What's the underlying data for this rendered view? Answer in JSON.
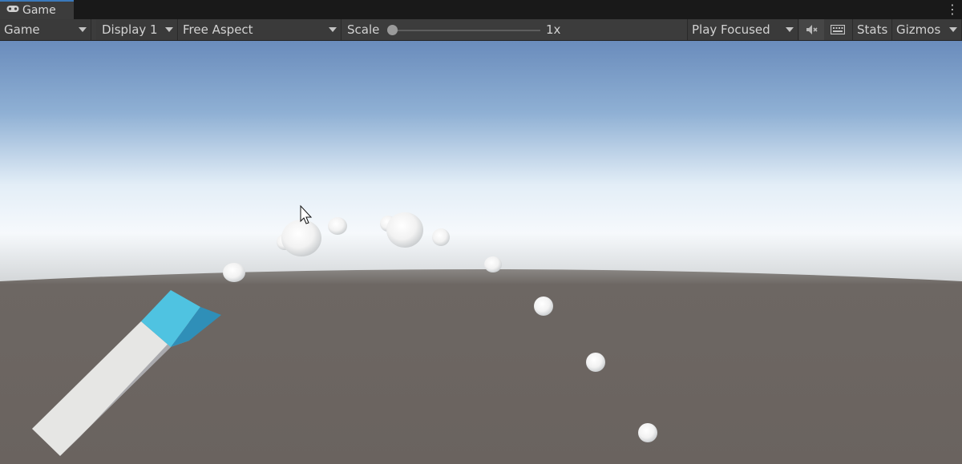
{
  "tab": {
    "title": "Game",
    "icon": "gamepad-icon"
  },
  "tab_menu_icon": "kebab-menu-icon",
  "toolbar": {
    "view_dropdown": "Game",
    "display_dropdown": "Display 1",
    "aspect_dropdown": "Free Aspect",
    "scale_label": "Scale",
    "scale_value": "1x",
    "scale_level": 0.0,
    "play_mode_dropdown": "Play Focused",
    "mute_icon": "mute-audio-icon",
    "keyboard_icon": "keyboard-shortcuts-icon",
    "stats_button": "Stats",
    "gizmos_button": "Gizmos"
  },
  "scene": {
    "sky_top": "#6a8cbc",
    "sky_horizon": "#f4f8fb",
    "ground": "#6a6460",
    "launcher_color": "#4fc3e1",
    "ball_color": "#f2f2f2"
  }
}
